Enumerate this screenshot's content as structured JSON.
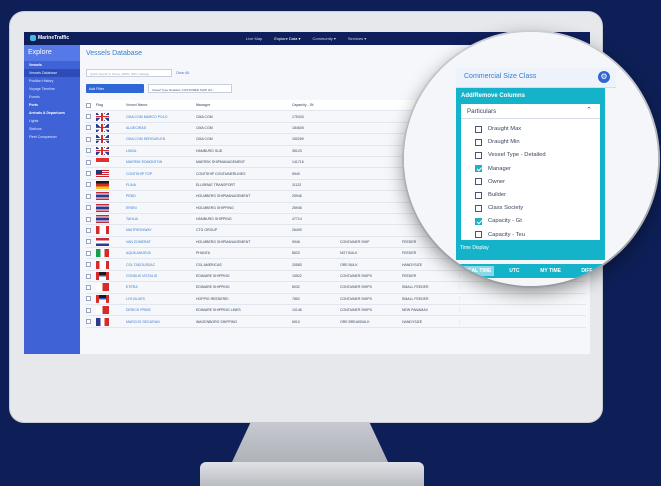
{
  "app": {
    "brand": "MarineTraffic",
    "nav": [
      "Live Map",
      "Explore Data ▾",
      "Community ▾",
      "Services ▾"
    ]
  },
  "sidebar": {
    "title": "Explore",
    "items": [
      {
        "label": "Vessels",
        "type": "group"
      },
      {
        "label": "Vessels Database",
        "type": "selected"
      },
      {
        "label": "Position History",
        "type": "item"
      },
      {
        "label": "Voyage Timeline",
        "type": "item"
      },
      {
        "label": "Events",
        "type": "item"
      },
      {
        "label": "Ports",
        "type": "group"
      },
      {
        "label": "Arrivals & Departures",
        "type": "group"
      },
      {
        "label": "Lights",
        "type": "item"
      },
      {
        "label": "Stations",
        "type": "item"
      },
      {
        "label": "Fleet Comparison",
        "type": "item"
      }
    ]
  },
  "main": {
    "title": "Vessels Database",
    "search_placeholder": "Quick Search in Name, MMSI, IMO, Callsign",
    "clear_all": "Clear All",
    "filter_chip": "Add Filter",
    "filter_value": "Vessel Type Detailed: CONTAINER SHIP, EX..."
  },
  "table": {
    "headers": [
      "Flag",
      "Vessel Name",
      "Manager",
      "Capacity - Gt",
      "",
      "",
      ""
    ],
    "rows": [
      {
        "flag": "f-uk",
        "name": "CMA CGM MARCO POLO",
        "manager": "CMA CGM",
        "cap": "175343",
        "type": "",
        "cls": ""
      },
      {
        "flag": "f-uk",
        "name": "ALGECIRAS",
        "manager": "CMA CGM",
        "cap": "184605",
        "type": "",
        "cls": ""
      },
      {
        "flag": "f-uk",
        "name": "CMA CGM KERGUELEN",
        "manager": "CMA CGM",
        "cap": "150269",
        "type": "",
        "cls": ""
      },
      {
        "flag": "f-uk",
        "name": "LINDA",
        "manager": "HAMBURG SUD",
        "cap": "35123",
        "type": "",
        "cls": ""
      },
      {
        "flag": "f-sg",
        "name": "MAERSK EDMONTON",
        "manager": "MAERSK SHIPMANAGEMENT",
        "cap": "141716",
        "type": "",
        "cls": ""
      },
      {
        "flag": "f-us",
        "name": "CONTSHIP TOP",
        "manager": "CONTSHIP CONTAINERLINES",
        "cap": "9940",
        "type": "",
        "cls": ""
      },
      {
        "flag": "f-de",
        "name": "FLINA",
        "manager": "ELLIBRAE TRANSPORT",
        "cap": "11122",
        "type": "",
        "cls": ""
      },
      {
        "flag": "f-th",
        "name": "PEBO",
        "manager": "HOLMBERG SHIPMANAGEMENT",
        "cap": "25946",
        "type": "",
        "cls": ""
      },
      {
        "flag": "f-th",
        "name": "ERIEN",
        "manager": "HOLMBERG SHIPPING",
        "cap": "25946",
        "type": "",
        "cls": ""
      },
      {
        "flag": "f-th",
        "name": "TAHLIA",
        "manager": "HAMBURG SHIPPING",
        "cap": "47714",
        "type": "",
        "cls": ""
      },
      {
        "flag": "f-ca",
        "name": "MAITRESHWAY",
        "manager": "CTG GROUP",
        "cap": "26490",
        "type": "",
        "cls": ""
      },
      {
        "flag": "f-nl",
        "name": "VAN ZOMERAT",
        "manager": "HOLMBERG SHIPMANAGEMENT",
        "cap": "9946",
        "type": "CONTAINER SHIP",
        "cls": "FEEDER"
      },
      {
        "flag": "f-it",
        "name": "AQUILANGEVA",
        "manager": "PHANTA",
        "cap": "8620",
        "type": "NOT BULK",
        "cls": "FEEDER"
      },
      {
        "flag": "f-ca",
        "name": "CSL TADOUSSAC",
        "manager": "CSL AMERICAS",
        "cap": "20583",
        "type": "ORE BULK",
        "cls": "HANDYSIZE"
      },
      {
        "flag": "f-ag",
        "name": "CONSUS VISTALIS",
        "manager": "EDIMARE SHIPPING",
        "cap": "15522",
        "type": "CONTAINER SHIPS",
        "cls": "FEEDER"
      },
      {
        "flag": "f-mt",
        "name": "ETERA",
        "manager": "EDIMARE SHIPPING",
        "cap": "8032",
        "type": "CONTAINER SHIPS",
        "cls": "SMALL FEEDER"
      },
      {
        "flag": "f-ag",
        "name": "LYS BLUES",
        "manager": "HOPPIG REEDEREI",
        "cap": "7852",
        "type": "CONTAINER SHIPS",
        "cls": "SMALL FEEDER"
      },
      {
        "flag": "f-mt",
        "name": "DERICK PRIDE",
        "manager": "EDIMARE SHIPPING LINES",
        "cap": "10146",
        "type": "CONTAINER SHIPS",
        "cls": "NEW PANAMAX"
      },
      {
        "flag": "f-rd",
        "name": "MARCOS SEGURAN",
        "manager": "WAGENBORG SHIPPING",
        "cap": "6910",
        "type": "ORE BREAKBULK",
        "cls": "HANDYSIZE"
      }
    ]
  },
  "columns_panel": {
    "header": "Commercial Size Class",
    "title": "Add/Remove Columns",
    "section": "Particulars",
    "options": [
      {
        "label": "Draught Max",
        "checked": false
      },
      {
        "label": "Draught Min",
        "checked": false
      },
      {
        "label": "Vessel Type - Detailed",
        "checked": false
      },
      {
        "label": "Manager",
        "checked": true
      },
      {
        "label": "Owner",
        "checked": false
      },
      {
        "label": "Builder",
        "checked": false
      },
      {
        "label": "Class Society",
        "checked": false
      },
      {
        "label": "Capacity - Gt",
        "checked": true
      },
      {
        "label": "Capacity - Teu",
        "checked": false
      }
    ],
    "time_display_label": "Time Display",
    "time_tabs": [
      "LOCAL TIME",
      "UTC",
      "MY TIME",
      "DIFF"
    ],
    "active_time_tab": 0
  },
  "colors": {
    "background": "#0d1f56",
    "topbar": "#0f1f5c",
    "sidebar": "#3f62d6",
    "accent_teal": "#15b3c9",
    "link_blue": "#3a7dd0"
  }
}
